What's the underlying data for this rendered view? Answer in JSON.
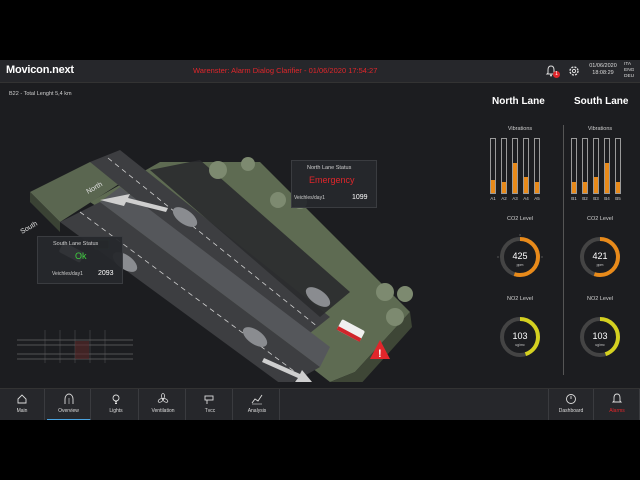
{
  "header": {
    "logo": "Movicon.next",
    "alarm_text": "Warenster: Alarm Dialog Clarifier - 01/06/2020 17:54:27",
    "notification_count": "1",
    "date": "01/06/2020",
    "time": "18:08:29",
    "languages": [
      "ITA",
      "ENG",
      "DEU"
    ]
  },
  "tunnel": {
    "label": "B22 - Total Lenght 5,4 km",
    "direction_north": "North",
    "direction_south": "South"
  },
  "north_status": {
    "title": "North Lane Status",
    "value": "Emergency",
    "vehicles_label": "Veichles/day1",
    "vehicles_value": "1099"
  },
  "south_status": {
    "title": "South Lane Status",
    "value": "Ok",
    "vehicles_label": "Veichles/day1",
    "vehicles_value": "2093"
  },
  "north_panel": {
    "title": "North Lane",
    "vibrations_label": "Vibrations",
    "vibrations": [
      {
        "label": "A1",
        "level": 0.25
      },
      {
        "label": "A2",
        "level": 0.2
      },
      {
        "label": "A3",
        "level": 0.55
      },
      {
        "label": "A4",
        "level": 0.3
      },
      {
        "label": "A5",
        "level": 0.2
      }
    ],
    "co2_label": "CO2 Level",
    "co2_value": "425",
    "co2_unit": "ppm",
    "co2_fraction": 0.55,
    "no2_label": "NO2 Level",
    "no2_value": "103",
    "no2_unit": "ug/mc",
    "no2_fraction": 0.45
  },
  "south_panel": {
    "title": "South Lane",
    "vibrations_label": "Vibrations",
    "vibrations": [
      {
        "label": "B1",
        "level": 0.2
      },
      {
        "label": "B2",
        "level": 0.2
      },
      {
        "label": "B3",
        "level": 0.3
      },
      {
        "label": "B4",
        "level": 0.55
      },
      {
        "label": "B5",
        "level": 0.2
      }
    ],
    "co2_label": "CO2 Level",
    "co2_value": "421",
    "co2_unit": "ppm",
    "co2_fraction": 0.55,
    "no2_label": "NO2 Level",
    "no2_value": "103",
    "no2_unit": "ug/mc",
    "no2_fraction": 0.45
  },
  "nav": {
    "items": [
      {
        "label": "Main",
        "icon": "home-icon"
      },
      {
        "label": "Overview",
        "icon": "overview-icon"
      },
      {
        "label": "Lights",
        "icon": "bulb-icon"
      },
      {
        "label": "Ventilation",
        "icon": "fan-icon"
      },
      {
        "label": "Tvcc",
        "icon": "camera-icon"
      },
      {
        "label": "Analysis",
        "icon": "chart-icon"
      }
    ],
    "right_items": [
      {
        "label": "Dashboard",
        "icon": "dashboard-icon"
      },
      {
        "label": "Alarms",
        "icon": "alarm-icon"
      }
    ]
  },
  "colors": {
    "accent_orange": "#e88a1a",
    "alarm_red": "#e0262b",
    "ok_green": "#3fd13f",
    "gauge_yellow": "#d4d020",
    "active_blue": "#4aa3df"
  }
}
